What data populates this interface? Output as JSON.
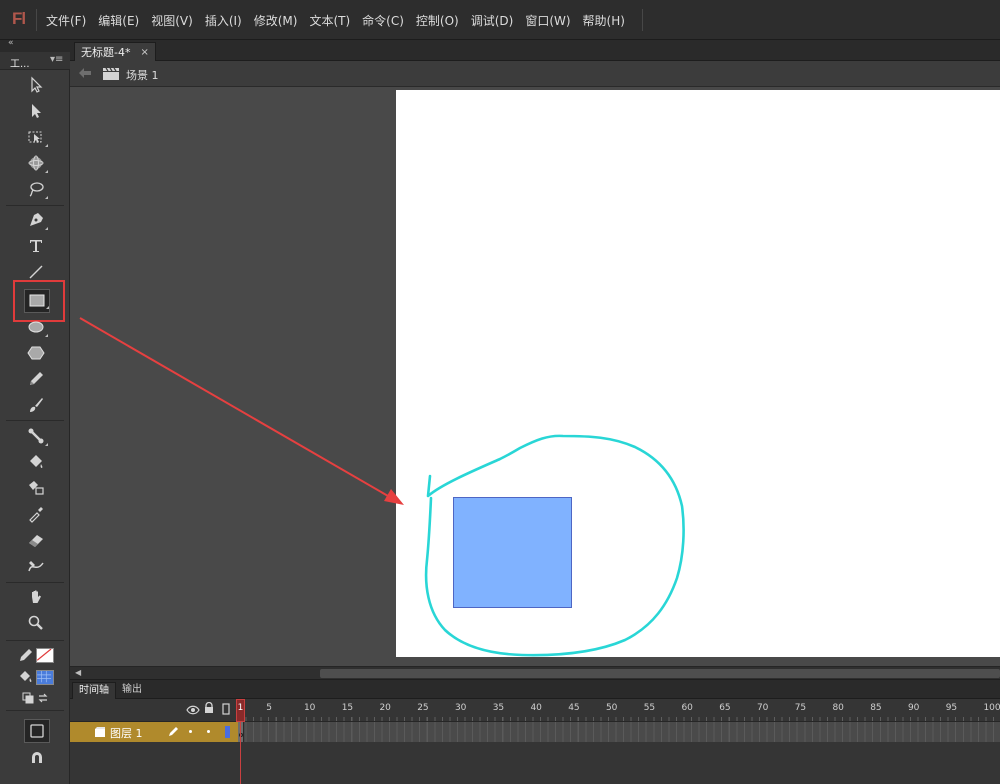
{
  "app": {
    "logo": "Fl",
    "menus": [
      "文件(F)",
      "编辑(E)",
      "视图(V)",
      "插入(I)",
      "修改(M)",
      "文本(T)",
      "命令(C)",
      "控制(O)",
      "调试(D)",
      "窗口(W)",
      "帮助(H)"
    ]
  },
  "tools_panel": {
    "tab_label": "工...",
    "collapse_glyph": "«",
    "menu_glyph": "▾≡",
    "items": [
      {
        "name": "selection",
        "icon": "selection-arrow-icon"
      },
      {
        "name": "subselection",
        "icon": "subselection-arrow-icon"
      },
      {
        "name": "free-transform",
        "icon": "free-transform-icon"
      },
      {
        "name": "3d-rotation",
        "icon": "3d-rotation-icon"
      },
      {
        "name": "lasso",
        "icon": "lasso-icon"
      },
      {
        "name": "pen",
        "icon": "pen-icon"
      },
      {
        "name": "text",
        "icon": "text-icon",
        "glyph": "T"
      },
      {
        "name": "line",
        "icon": "line-icon"
      },
      {
        "name": "rectangle",
        "icon": "rectangle-icon",
        "selected": true
      },
      {
        "name": "oval",
        "icon": "oval-icon"
      },
      {
        "name": "polystar",
        "icon": "polystar-icon"
      },
      {
        "name": "pencil",
        "icon": "pencil-icon"
      },
      {
        "name": "brush",
        "icon": "brush-icon"
      },
      {
        "name": "bone",
        "icon": "bone-icon"
      },
      {
        "name": "paint-bucket",
        "icon": "paint-bucket-icon"
      },
      {
        "name": "ink-bottle",
        "icon": "ink-bottle-icon"
      },
      {
        "name": "eyedropper",
        "icon": "eyedropper-icon"
      },
      {
        "name": "eraser",
        "icon": "eraser-icon"
      },
      {
        "name": "width",
        "icon": "width-tool-icon"
      },
      {
        "name": "hand",
        "icon": "hand-icon"
      },
      {
        "name": "zoom",
        "icon": "zoom-icon"
      }
    ],
    "stroke_color": "none",
    "fill_color": "#4a7cdb",
    "highlight_color": "#e03b3b"
  },
  "document": {
    "tab_label": "无标题-4*",
    "close_glyph": "×",
    "scene_label": "场景 1"
  },
  "stage": {
    "background": "#ffffff",
    "rectangle_fill": "#80b2ff",
    "rectangle_stroke": "#4e66c4",
    "freehand_stroke": "#29d6d6",
    "annotation_arrow_color": "#e64040"
  },
  "timeline": {
    "tabs": [
      "时间轴",
      "输出"
    ],
    "active_tab": "时间轴",
    "frame_numbers": [
      "1",
      "5",
      "10",
      "15",
      "20",
      "25",
      "30",
      "35",
      "40",
      "45",
      "50",
      "55",
      "60",
      "65",
      "70",
      "75",
      "80",
      "85",
      "90",
      "95",
      "100"
    ],
    "current_frame": "1",
    "layer": {
      "name": "图层 1",
      "color": "#b08a2c",
      "swatch": "#4a6de0"
    }
  }
}
